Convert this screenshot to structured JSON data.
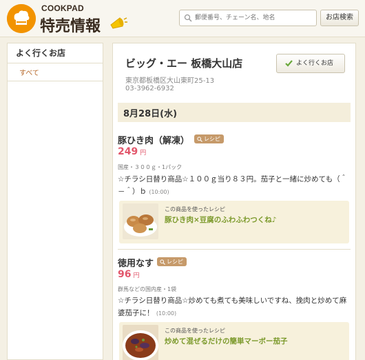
{
  "header": {
    "logo_brand": "COOKPAD",
    "logo_title": "特売情報",
    "search_placeholder": "郵便番号、チェーン名、地名",
    "search_button": "お店検索"
  },
  "sidebar": {
    "title": "よく行くお店",
    "items": [
      {
        "label": "すべて"
      }
    ]
  },
  "store": {
    "name": "ビッグ・エー 板橋大山店",
    "favorite_button": "よく行くお店",
    "address": "東京都板橋区大山東町25-13",
    "tel": "03-3962-6932"
  },
  "date": "8月28日(水)",
  "items": [
    {
      "name": "豚ひき肉（解凍）",
      "tag": "レシピ",
      "price": "249",
      "yen": "円",
      "origin": "国産・３００ｇ・1パック",
      "desc": "☆チラシ日替り商品☆１００ｇ当り８３円。茄子と一緒に炒めても（＾－＾）ｂ",
      "time": "(10:00)",
      "recipe_label": "この商品を使ったレシピ",
      "recipe_title": "豚ひき肉×豆腐のふわふわつくね♪"
    },
    {
      "name": "徳用なす",
      "tag": "レシピ",
      "price": "96",
      "yen": "円",
      "origin": "群馬などの国内産・1袋",
      "desc": "☆チラシ日替り商品☆炒めても煮ても美味しいですね、挽肉と炒めて麻婆茄子に！",
      "time": "(10:00)",
      "recipe_label": "この商品を使ったレシピ",
      "recipe_title": "炒めて混ぜるだけの簡単マーボー茄子"
    }
  ],
  "colors": {
    "accent_orange": "#f29300",
    "price_pink": "#e2566b",
    "recipe_green": "#7c9a2c",
    "link_brown": "#b76a2d"
  }
}
